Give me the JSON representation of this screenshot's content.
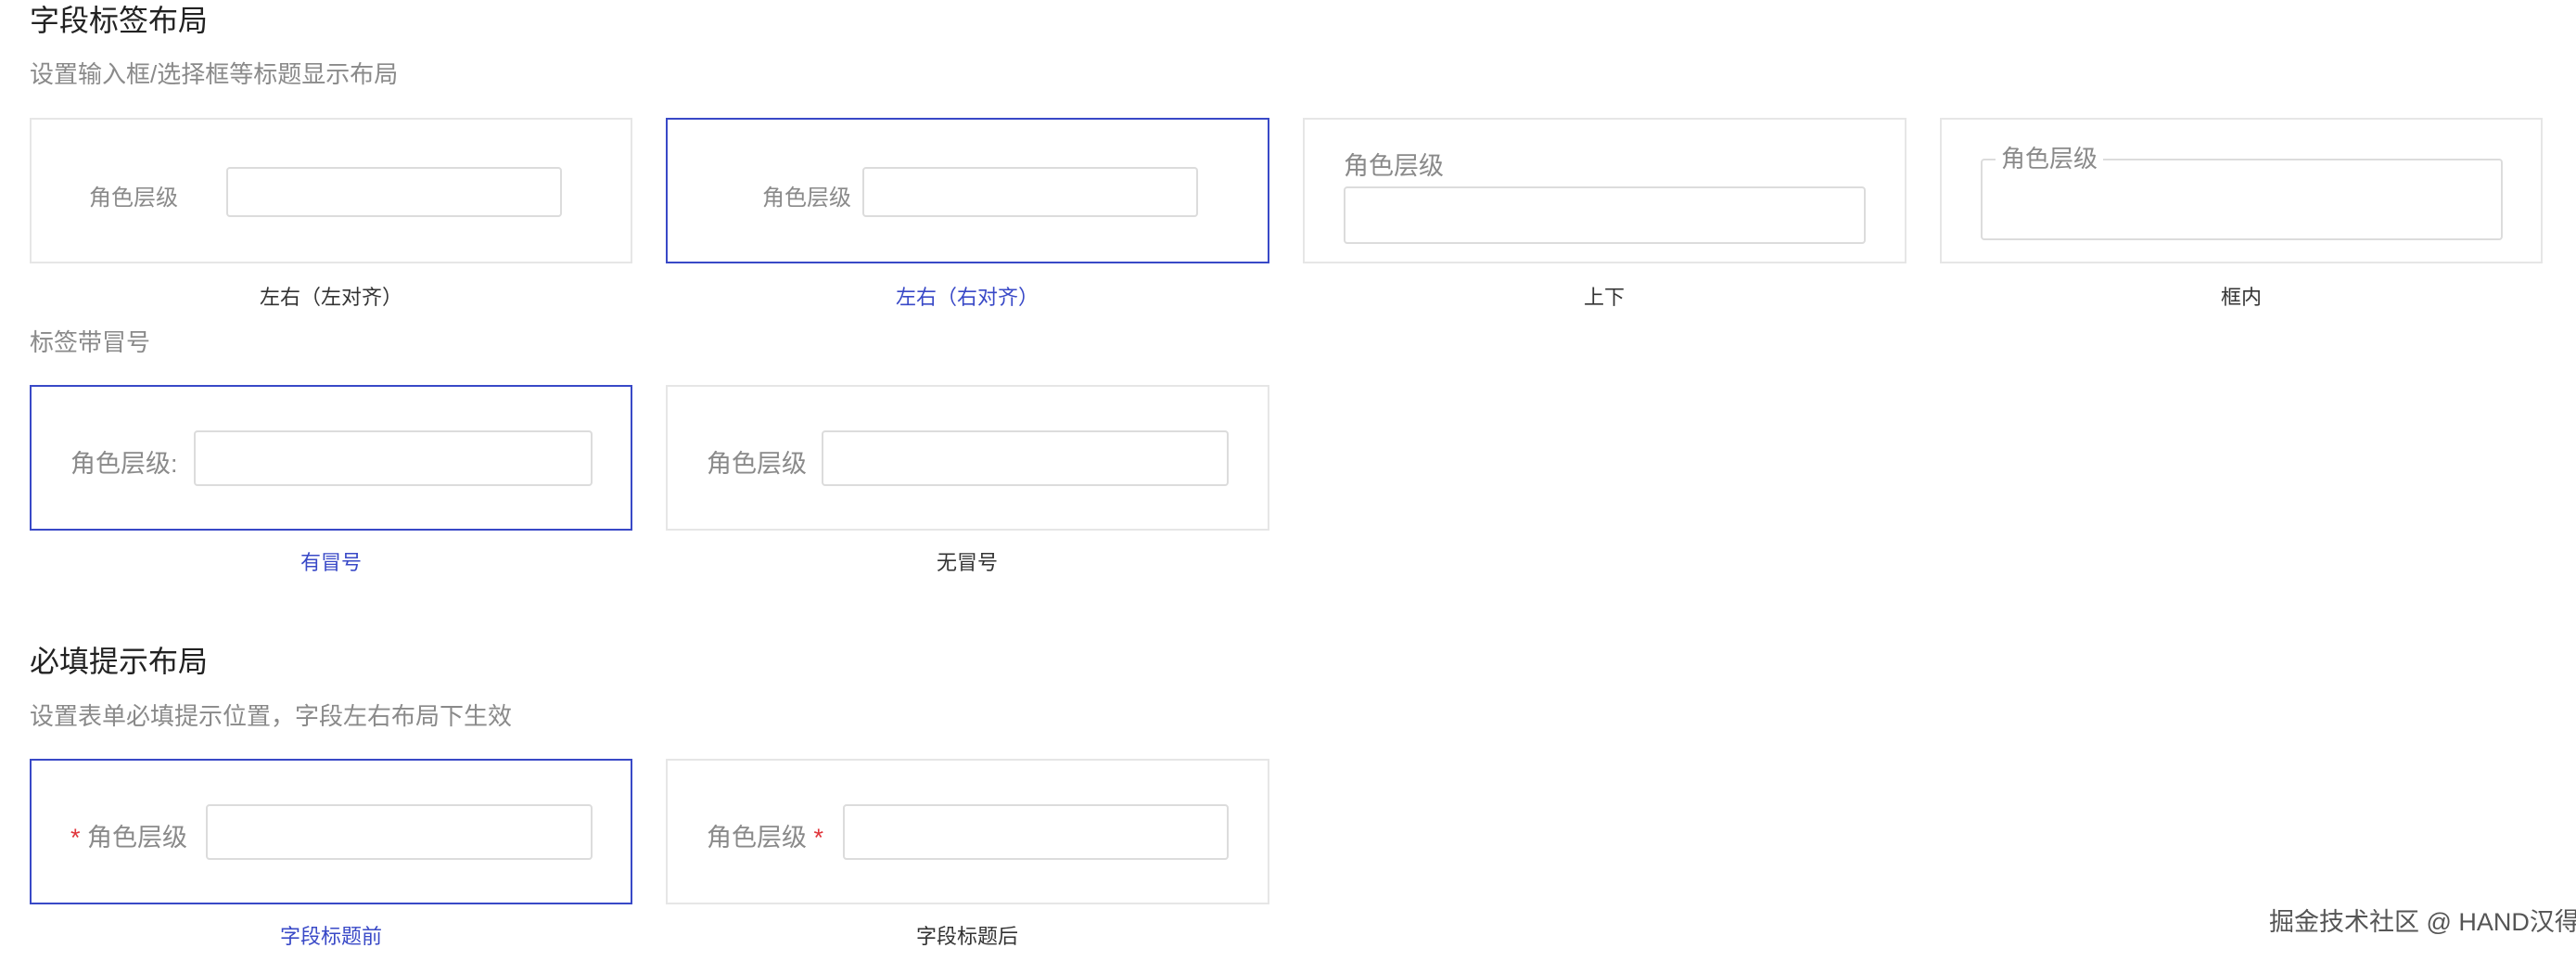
{
  "field_label_layout": {
    "title": "字段标签布局",
    "description": "设置输入框/选择框等标题显示布局",
    "options": [
      {
        "caption": "左右（左对齐）",
        "label": "角色层级",
        "selected": false
      },
      {
        "caption": "左右（右对齐）",
        "label": "角色层级",
        "selected": true
      },
      {
        "caption": "上下",
        "label": "角色层级",
        "selected": false
      },
      {
        "caption": "框内",
        "label": "角色层级",
        "selected": false
      }
    ]
  },
  "colon": {
    "title": "标签带冒号",
    "options": [
      {
        "caption": "有冒号",
        "label": "角色层级:",
        "selected": true
      },
      {
        "caption": "无冒号",
        "label": "角色层级",
        "selected": false
      }
    ]
  },
  "required_layout": {
    "title": "必填提示布局",
    "description": "设置表单必填提示位置，字段左右布局下生效",
    "options": [
      {
        "caption": "字段标题前",
        "label": "角色层级",
        "marker": "*",
        "selected": true
      },
      {
        "caption": "字段标题后",
        "label": "角色层级",
        "marker": "*",
        "selected": false
      }
    ]
  },
  "watermark": "掘金技术社区 @ HAND汉得",
  "colors": {
    "accent": "#3949c7",
    "required": "#e0353b",
    "border": "#e6e6e6"
  }
}
